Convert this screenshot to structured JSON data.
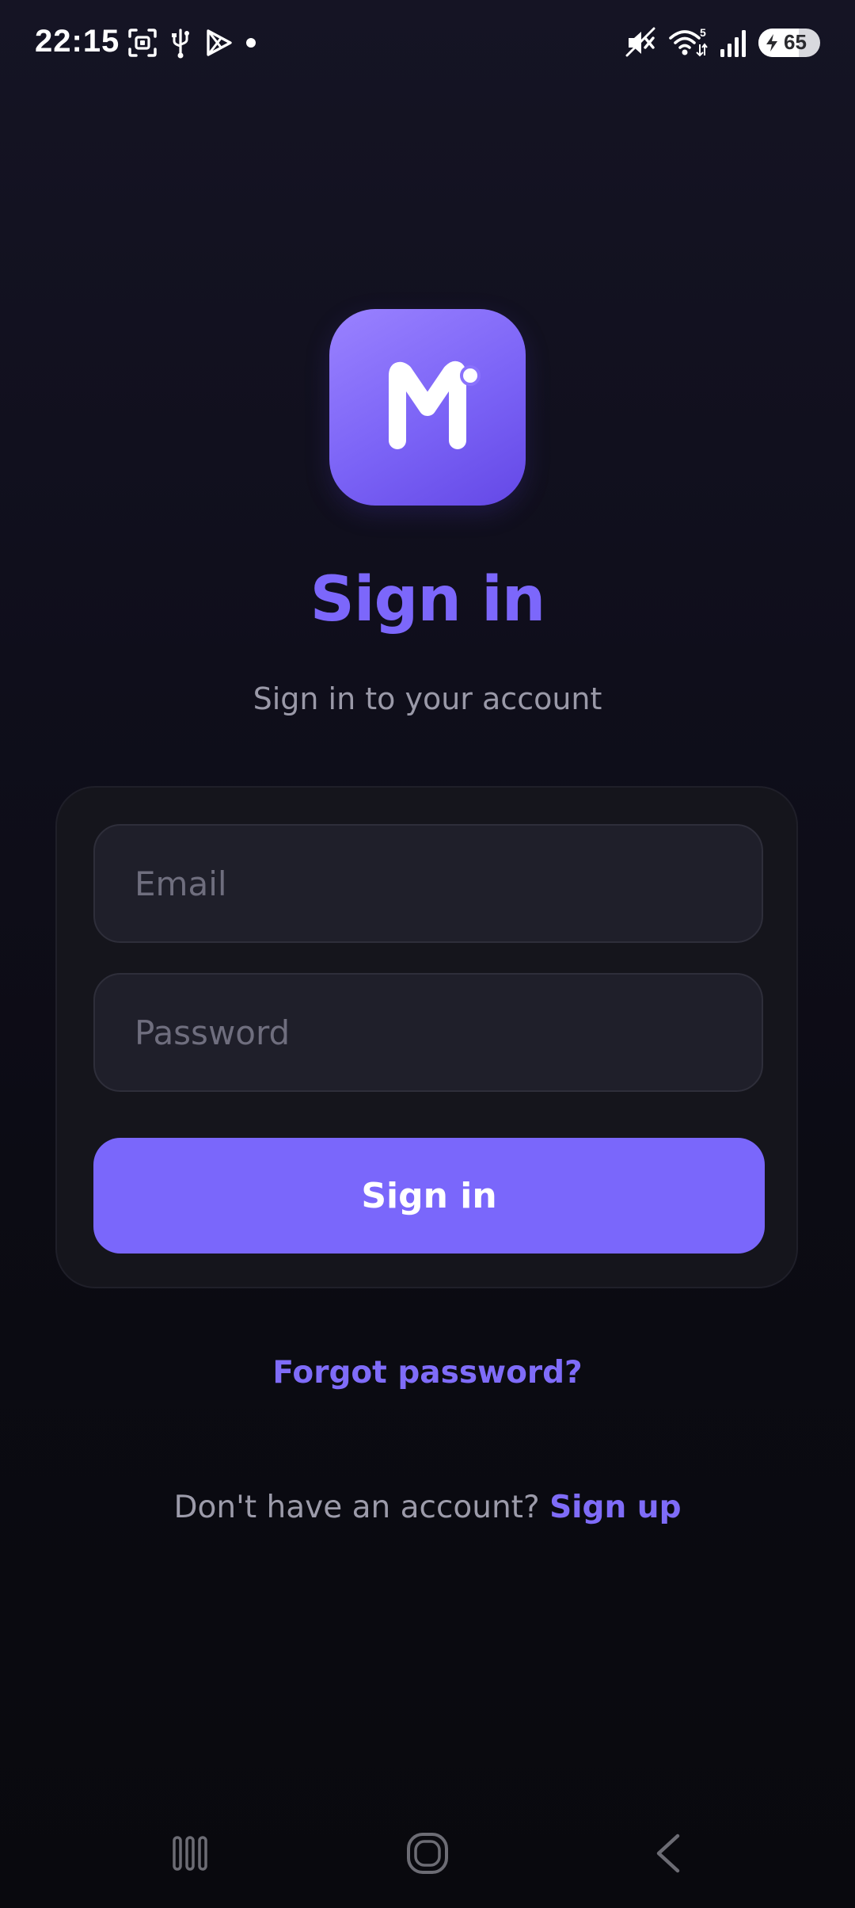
{
  "status_bar": {
    "time": "22:15",
    "battery_level": "65",
    "left_icons": [
      "screenshot-icon",
      "usb-icon",
      "play-store-icon",
      "dot-icon"
    ],
    "right_icons": [
      "mute-icon",
      "wifi-icon",
      "signal-icon",
      "battery-icon"
    ]
  },
  "header": {
    "title": "Sign in",
    "subtitle": "Sign in to your account"
  },
  "form": {
    "email_placeholder": "Email",
    "password_placeholder": "Password",
    "submit_label": "Sign in"
  },
  "links": {
    "forgot_password": "Forgot password?",
    "signup_prompt": "Don't have an account?",
    "signup_label": "Sign up"
  },
  "theme": {
    "accent": "#7a67fb",
    "background": "#0f0e1b",
    "card": "#15151c"
  },
  "nav_bar": {
    "icons": [
      "recents-icon",
      "home-icon",
      "back-icon"
    ]
  }
}
